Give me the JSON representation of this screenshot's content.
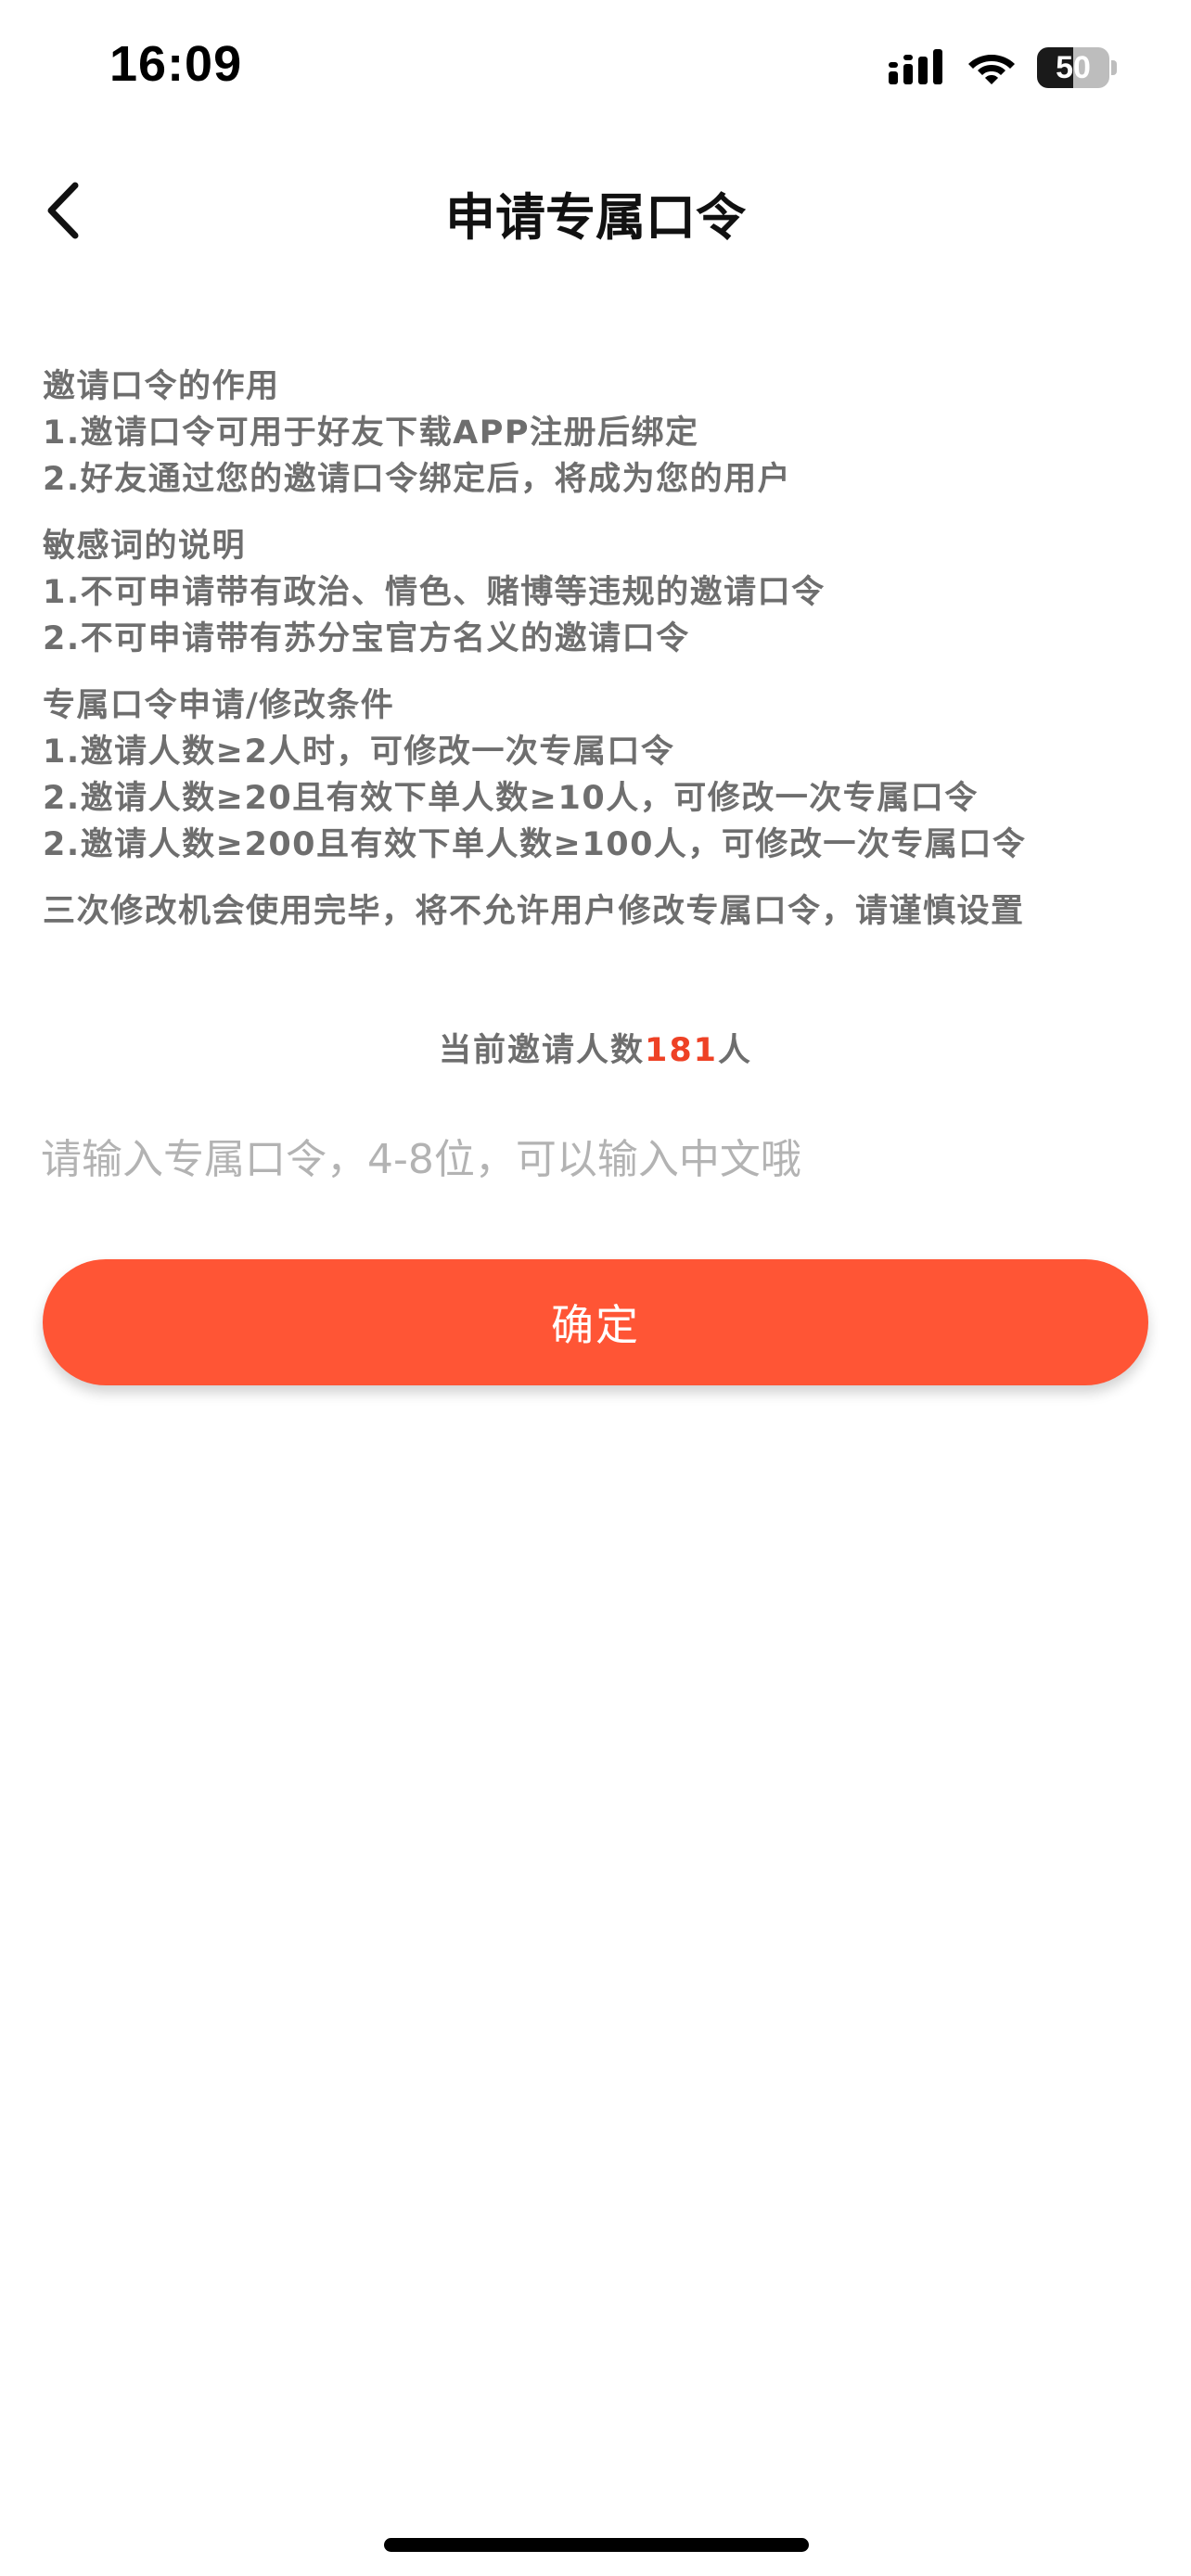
{
  "status_bar": {
    "time": "16:09",
    "battery_level": "50",
    "icons": [
      "cellular-signal-icon",
      "wifi-icon",
      "battery-icon"
    ]
  },
  "nav": {
    "title": "申请专属口令",
    "back_icon": "chevron-left-icon"
  },
  "info": {
    "sections": [
      {
        "heading": "邀请口令的作用",
        "lines": [
          "1.邀请口令可用于好友下载APP注册后绑定",
          "2.好友通过您的邀请口令绑定后，将成为您的用户"
        ]
      },
      {
        "heading": "敏感词的说明",
        "lines": [
          "1.不可申请带有政治、情色、赌博等违规的邀请口令",
          "2.不可申请带有苏分宝官方名义的邀请口令"
        ]
      },
      {
        "heading": "专属口令申请/修改条件",
        "lines": [
          "1.邀请人数≥2人时，可修改一次专属口令",
          "2.邀请人数≥20且有效下单人数≥10人，可修改一次专属口令",
          "2.邀请人数≥200且有效下单人数≥100人，可修改一次专属口令"
        ]
      }
    ],
    "notice": "三次修改机会使用完毕，将不允许用户修改专属口令，请谨慎设置"
  },
  "count": {
    "prefix": "当前邀请人数",
    "value": "181",
    "suffix": "人"
  },
  "input": {
    "value": "",
    "placeholder": "请输入专属口令，4-8位，可以输入中文哦"
  },
  "confirm_label": "确定",
  "colors": {
    "accent": "#ff5535",
    "count_highlight": "#ee4125",
    "body_text": "#6e6e6e",
    "placeholder": "#b3b3b3"
  }
}
